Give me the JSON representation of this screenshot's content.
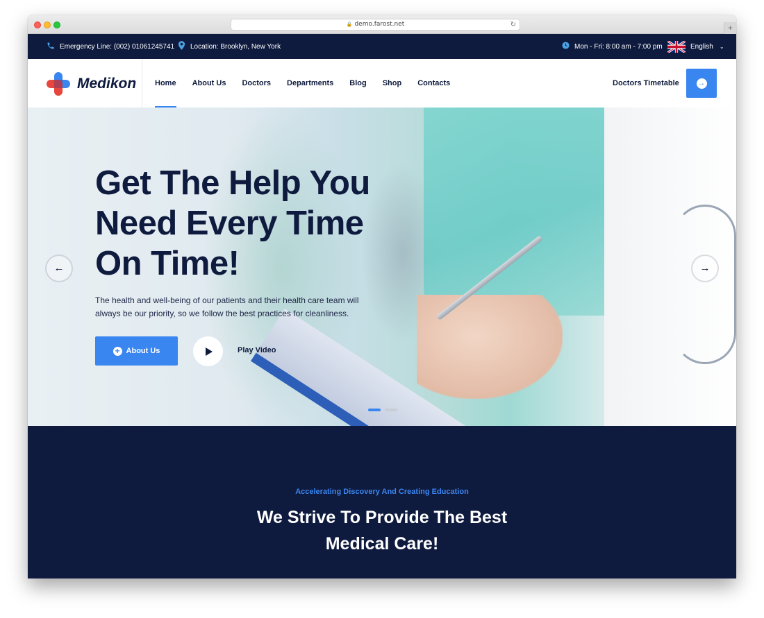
{
  "browser": {
    "url": "demo.farost.net",
    "new_tab": "+"
  },
  "topbar": {
    "phone": "Emergency Line: (002) 01061245741",
    "location": "Location: Brooklyn, New York",
    "hours": "Mon - Fri: 8:00 am - 7:00 pm",
    "language": "English"
  },
  "nav": {
    "logo": "Medikon",
    "items": [
      {
        "label": "Home"
      },
      {
        "label": "About Us"
      },
      {
        "label": "Doctors"
      },
      {
        "label": "Departments"
      },
      {
        "label": "Blog"
      },
      {
        "label": "Shop"
      },
      {
        "label": "Contacts"
      }
    ],
    "timetable": "Doctors Timetable"
  },
  "hero": {
    "title": "Get The Help You Need Every Time On Time!",
    "text": "The health and well-being of our patients and their health care team will always be our priority, so we follow the best practices for cleanliness.",
    "button": "About Us",
    "play": "Play Video",
    "slides": 2,
    "active_slide": 1
  },
  "section": {
    "eyebrow": "Accelerating Discovery And Creating Education",
    "title": "We Strive To Provide The Best Medical Care!"
  },
  "colors": {
    "navy": "#0f1b3e",
    "accent": "#3a86f0",
    "logo_red": "#e8453c"
  }
}
